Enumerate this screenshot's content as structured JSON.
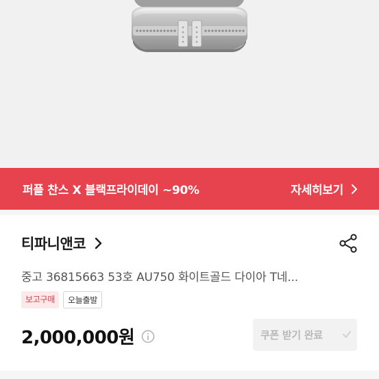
{
  "promo": {
    "text": "퍼플 찬스 X 블랙프라이데이 ~90%",
    "link_label": "자세히보기"
  },
  "product": {
    "brand": "티파니앤코",
    "title": "중고 36815663 53호 AU750 화이트골드 다이아 T네...",
    "badges": [
      "보고구매",
      "오늘출발"
    ],
    "price": "2,000,000원",
    "coupon_label": "쿠폰 받기 완료"
  },
  "colors": {
    "promo_bg": "#e6434f",
    "badge_pink_text": "#d9404c"
  },
  "icons": {
    "share": "share-icon",
    "info": "info-circle-icon",
    "brand_chevron": "chevron-right-icon"
  }
}
